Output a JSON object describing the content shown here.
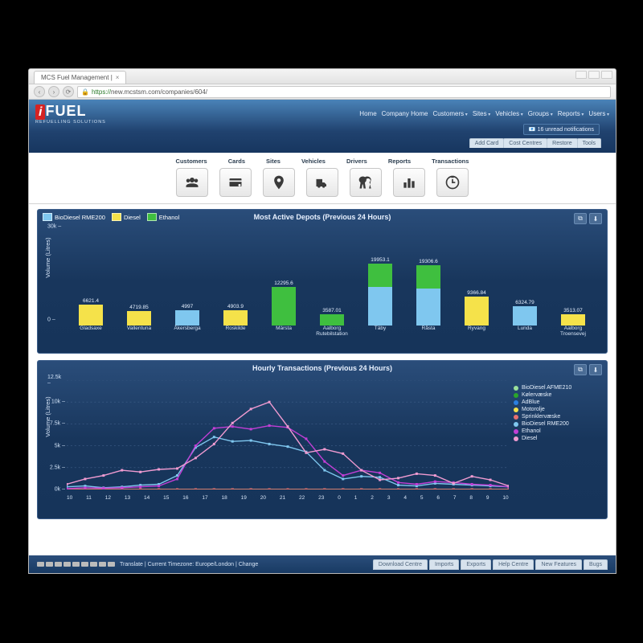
{
  "browser": {
    "tab_title": "MCS Fuel Management |",
    "url_prefix": "https://",
    "url": "new.mcstsm.com/companies/604/"
  },
  "header": {
    "logo_i": "i",
    "logo_fuel": "FUEL",
    "logo_sub": "REFUELLING SOLUTIONS",
    "nav": [
      "Home",
      "Company Home",
      "Customers",
      "Sites",
      "Vehicles",
      "Groups",
      "Reports",
      "Users"
    ],
    "notification": "16 unread notifications",
    "subtabs": [
      "Add Card",
      "Cost Centres",
      "Restore",
      "Tools"
    ]
  },
  "iconbar": {
    "labels": [
      "Customers",
      "Cards",
      "Sites",
      "Vehicles",
      "Drivers",
      "Reports",
      "Transactions"
    ]
  },
  "card1": {
    "title": "Most Active Depots (Previous 24 Hours)",
    "ylabel": "Volume (Litres)",
    "legend": [
      {
        "name": "BioDiesel RME200",
        "color": "#7fc7ef"
      },
      {
        "name": "Diesel",
        "color": "#f5e24a"
      },
      {
        "name": "Ethanol",
        "color": "#3fbf3f"
      }
    ]
  },
  "card2": {
    "title": "Hourly Transactions (Previous 24 Hours)",
    "ylabel": "Volume (Litres)",
    "legend": [
      {
        "name": "BioDiesel AFME210",
        "color": "#9be09b"
      },
      {
        "name": "Kølervæske",
        "color": "#2aa52a"
      },
      {
        "name": "AdBlue",
        "color": "#2a7fe0"
      },
      {
        "name": "Motorolje",
        "color": "#f3df4c"
      },
      {
        "name": "Sprinklervæske",
        "color": "#e86f6f"
      },
      {
        "name": "BioDiesel RME200",
        "color": "#7fc7ef"
      },
      {
        "name": "Ethanol",
        "color": "#c23fd6"
      },
      {
        "name": "Diesel",
        "color": "#f09bd1"
      }
    ]
  },
  "footer": {
    "translate": "Translate | Current Timezone: Europe/London | Change",
    "links": [
      "Download Centre",
      "Imports",
      "Exports",
      "Help Centre",
      "New Features",
      "Bugs"
    ]
  },
  "chart_data": [
    {
      "type": "bar",
      "title": "Most Active Depots (Previous 24 Hours)",
      "ylabel": "Volume (Litres)",
      "ylim": [
        0,
        30000
      ],
      "yticks": [
        0,
        30000
      ],
      "categories": [
        "Gladsaxe",
        "Vallentuna",
        "Åkersberga",
        "Roskilde",
        "Märsta",
        "Aalborg Rutebilstation",
        "Täby",
        "Råsta",
        "Ryvang",
        "Lunda",
        "Aalborg Troensevej"
      ],
      "stack": true,
      "series": [
        {
          "name": "BioDiesel RME200",
          "color": "#7fc7ef",
          "values": [
            0,
            0,
            4997,
            0,
            0,
            0,
            12500,
            12000,
            0,
            6324.79,
            0
          ]
        },
        {
          "name": "Diesel",
          "color": "#f5e24a",
          "values": [
            6621.4,
            4719.85,
            0,
            4903.9,
            0,
            0,
            0,
            0,
            9366.84,
            0,
            3513.07
          ]
        },
        {
          "name": "Ethanol",
          "color": "#3fbf3f",
          "values": [
            0,
            0,
            0,
            0,
            12295.6,
            3587.01,
            7453.1,
            7306.6,
            0,
            0,
            0
          ]
        }
      ],
      "totals": [
        6621.4,
        4719.85,
        4997,
        4903.9,
        12295.6,
        3587.01,
        19953.1,
        19306.6,
        9366.84,
        6324.79,
        3513.07
      ]
    },
    {
      "type": "line",
      "title": "Hourly Transactions (Previous 24 Hours)",
      "ylabel": "Volume (Litres)",
      "ylim": [
        0,
        12500
      ],
      "yticks": [
        0,
        2500,
        5000,
        7500,
        10000,
        12500
      ],
      "x": [
        10,
        11,
        12,
        13,
        14,
        15,
        16,
        17,
        18,
        19,
        20,
        21,
        22,
        23,
        0,
        1,
        2,
        3,
        4,
        5,
        6,
        7,
        8,
        9,
        10
      ],
      "series": [
        {
          "name": "BioDiesel AFME210",
          "color": "#9be09b",
          "values": [
            0,
            0,
            0,
            0,
            0,
            0,
            0,
            0,
            0,
            0,
            0,
            0,
            0,
            0,
            0,
            0,
            0,
            0,
            0,
            0,
            0,
            0,
            0,
            0,
            0
          ]
        },
        {
          "name": "Kølervæske",
          "color": "#2aa52a",
          "values": [
            0,
            0,
            0,
            0,
            0,
            0,
            0,
            0,
            0,
            0,
            0,
            0,
            0,
            0,
            0,
            0,
            0,
            0,
            0,
            0,
            0,
            0,
            0,
            0,
            0
          ]
        },
        {
          "name": "AdBlue",
          "color": "#2a7fe0",
          "values": [
            0,
            0,
            0,
            0,
            0,
            0,
            0,
            0,
            0,
            0,
            0,
            0,
            0,
            0,
            0,
            0,
            0,
            0,
            0,
            0,
            0,
            0,
            0,
            0,
            0
          ]
        },
        {
          "name": "Motorolje",
          "color": "#f3df4c",
          "values": [
            0,
            0,
            0,
            0,
            0,
            0,
            0,
            0,
            0,
            0,
            0,
            0,
            0,
            0,
            0,
            0,
            0,
            0,
            0,
            0,
            0,
            0,
            0,
            0,
            0
          ]
        },
        {
          "name": "Sprinklervæske",
          "color": "#e86f6f",
          "values": [
            0,
            0,
            0,
            0,
            0,
            0,
            0,
            0,
            0,
            0,
            0,
            0,
            0,
            0,
            0,
            0,
            0,
            0,
            0,
            0,
            0,
            0,
            0,
            0,
            0
          ]
        },
        {
          "name": "BioDiesel RME200",
          "color": "#7fc7ef",
          "values": [
            300,
            400,
            200,
            300,
            500,
            600,
            1600,
            4800,
            6000,
            5500,
            5600,
            5200,
            4900,
            4300,
            2200,
            1200,
            1500,
            1400,
            500,
            400,
            700,
            600,
            500,
            400,
            300
          ]
        },
        {
          "name": "Ethanol",
          "color": "#c23fd6",
          "values": [
            100,
            200,
            150,
            200,
            300,
            400,
            1200,
            5000,
            7000,
            7200,
            6900,
            7300,
            7100,
            5800,
            3200,
            1600,
            2200,
            1900,
            800,
            600,
            900,
            800,
            600,
            500,
            300
          ]
        },
        {
          "name": "Diesel",
          "color": "#f09bd1",
          "values": [
            600,
            1200,
            1600,
            2200,
            2000,
            2300,
            2400,
            3600,
            5200,
            7600,
            9200,
            10000,
            7200,
            4200,
            4600,
            4100,
            2200,
            1100,
            1300,
            1800,
            1600,
            700,
            1500,
            1100,
            400
          ]
        }
      ]
    }
  ]
}
